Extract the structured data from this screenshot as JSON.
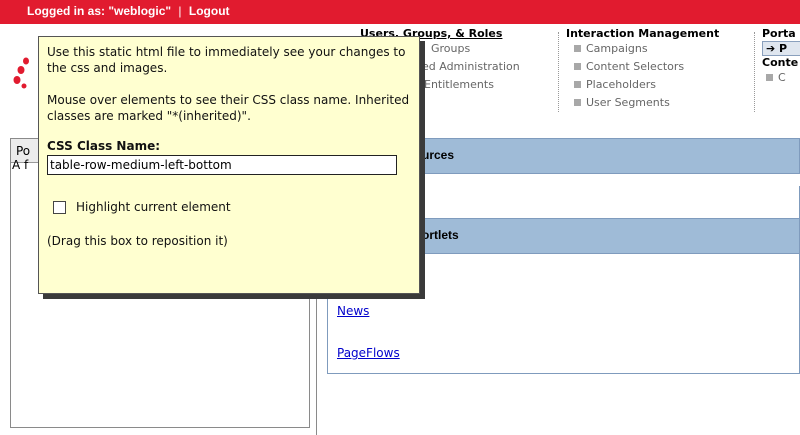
{
  "topbar": {
    "logged_in": "Logged in as: \"weblogic\"",
    "separator": "|",
    "logout": "Logout"
  },
  "menus": {
    "users": {
      "title": "Users, Groups, & Roles",
      "items": [
        "Groups",
        "ed Administration",
        "Entitlements"
      ]
    },
    "interaction": {
      "title": "Interaction Management",
      "items": [
        "Campaigns",
        "Content Selectors",
        "Placeholders",
        "User Segments"
      ]
    },
    "portal": {
      "title": "Porta",
      "selected": "➔ P",
      "sub_title": "Conte",
      "sub_item": "C"
    }
  },
  "left": {
    "tab_label": "Po",
    "text": "A f"
  },
  "right": {
    "section1": "urces",
    "section2": "ortlets",
    "links": [
      "News",
      "PageFlows"
    ]
  },
  "helper": {
    "intro": "Use this static html file to immediately see your changes to the css and images.",
    "mouse_hint": "Mouse over elements to see their CSS class name. Inherited classes are marked \"*(inherited)\".",
    "class_label": "CSS Class Name:",
    "class_value": "table-row-medium-left-bottom",
    "highlight_label": "Highlight current element",
    "drag_hint": "(Drag this box to reposition it)"
  },
  "colors": {
    "topbar": "#e11b2f",
    "helper_bg": "#ffffd0",
    "section_header": "#9fbbd7",
    "link": "#0000cc"
  }
}
